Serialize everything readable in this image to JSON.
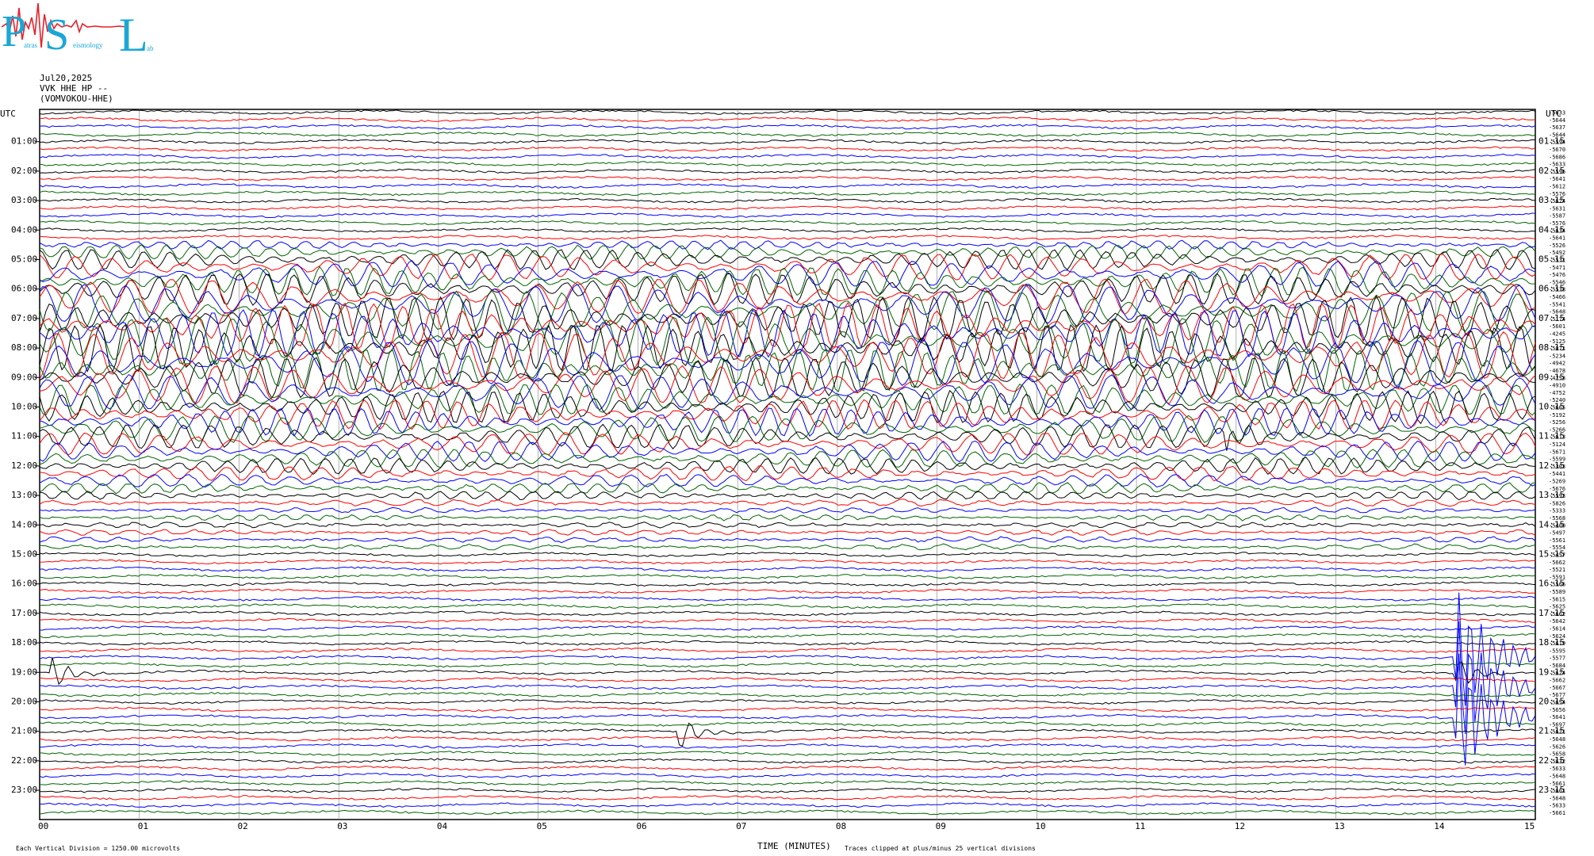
{
  "header": {
    "date": "Jul20,2025",
    "station": "VVK HHE HP --",
    "station_name": "(VOMVOKOU-HHE)"
  },
  "logo": {
    "letters": [
      "P",
      "S",
      "L"
    ],
    "subtext": [
      "atras",
      "eismology",
      "ab"
    ],
    "color": "#1aa7d6",
    "trace_color": "#e8202a"
  },
  "labels": {
    "utc_left": "UTC",
    "utc_right": "UTC",
    "x_axis_title": "TIME (MINUTES)",
    "scale_note": "Each Vertical Division = 1250.00 microvolts",
    "clip_note": "Traces clipped at plus/minus 25 vertical divisions"
  },
  "colors": {
    "trace_cycle": [
      "#000000",
      "#ff0000",
      "#0000ff",
      "#006400"
    ],
    "grid": "#808080"
  },
  "chart_data": {
    "type": "line",
    "title": "",
    "xlabel": "TIME (MINUTES)",
    "ylabel": "UTC",
    "xlim": [
      0,
      15
    ],
    "x_ticks": [
      "00",
      "01",
      "02",
      "03",
      "04",
      "05",
      "06",
      "07",
      "08",
      "09",
      "10",
      "11",
      "12",
      "13",
      "14",
      "15"
    ],
    "left_hour_labels": [
      "01:00",
      "02:00",
      "03:00",
      "04:00",
      "05:00",
      "06:00",
      "07:00",
      "08:00",
      "09:00",
      "10:00",
      "11:00",
      "12:00",
      "13:00",
      "14:00",
      "15:00",
      "16:00",
      "17:00",
      "18:00",
      "19:00",
      "20:00",
      "21:00",
      "22:00",
      "23:00"
    ],
    "right_hour_labels": [
      "01:15",
      "02:15",
      "03:15",
      "04:15",
      "05:15",
      "06:15",
      "07:15",
      "08:15",
      "09:15",
      "10:15",
      "11:15",
      "12:15",
      "13:15",
      "14:15",
      "15:15",
      "16:15",
      "17:15",
      "18:15",
      "19:15",
      "20:15",
      "21:15",
      "22:15",
      "23:15"
    ],
    "traces_per_hour": 4,
    "trace_count": 96,
    "trace_minutes": 15,
    "offset_labels": [
      -5633,
      -5644,
      -5637,
      -5644,
      -5594,
      -5670,
      -5686,
      -5633,
      -5596,
      -5641,
      -5612,
      -5576,
      -5624,
      -5631,
      -5587,
      -5576,
      -5634,
      -5641,
      -5526,
      -5492,
      -5531,
      -5471,
      -5476,
      -5546,
      -5538,
      -5466,
      -5541,
      -5648,
      -5174,
      -5601,
      -4245,
      -5125,
      -5071,
      -5234,
      -4942,
      -4678,
      -4758,
      -4910,
      -4752,
      -5240,
      -5665,
      -5192,
      -5256,
      -5266,
      -5613,
      -5124,
      -5671,
      -5599,
      -5303,
      -5441,
      -5269,
      -5676,
      -5593,
      -5826,
      -5333,
      -5568,
      -5400,
      -5497,
      -5561,
      -5554,
      -5457,
      -5662,
      -5521,
      -5591,
      -5566,
      -5589,
      -5615,
      -5625,
      -5662,
      -5642,
      -5614,
      -5624,
      -5619,
      -5595,
      -5577,
      -5684,
      -5624,
      -5662,
      -5667,
      -5677,
      -5654,
      -5656,
      -5641,
      -5697,
      -5621,
      -5648,
      -5626,
      -5658,
      -5632,
      -5633,
      -5648,
      -5661,
      -5661,
      -5648,
      -5633,
      -5661
    ],
    "grid": true,
    "events": [
      {
        "type": "tremor",
        "hours": [
          5,
          10
        ],
        "description": "large-amplitude oscillations"
      },
      {
        "type": "local_event",
        "hour": 19,
        "minute": 14.2
      },
      {
        "type": "local_event",
        "hour": 11,
        "minute": 11.9
      },
      {
        "type": "local_event",
        "hour": 19,
        "minute": 0.1
      },
      {
        "type": "local_event",
        "hour": 21,
        "minute": 6.4
      }
    ]
  }
}
